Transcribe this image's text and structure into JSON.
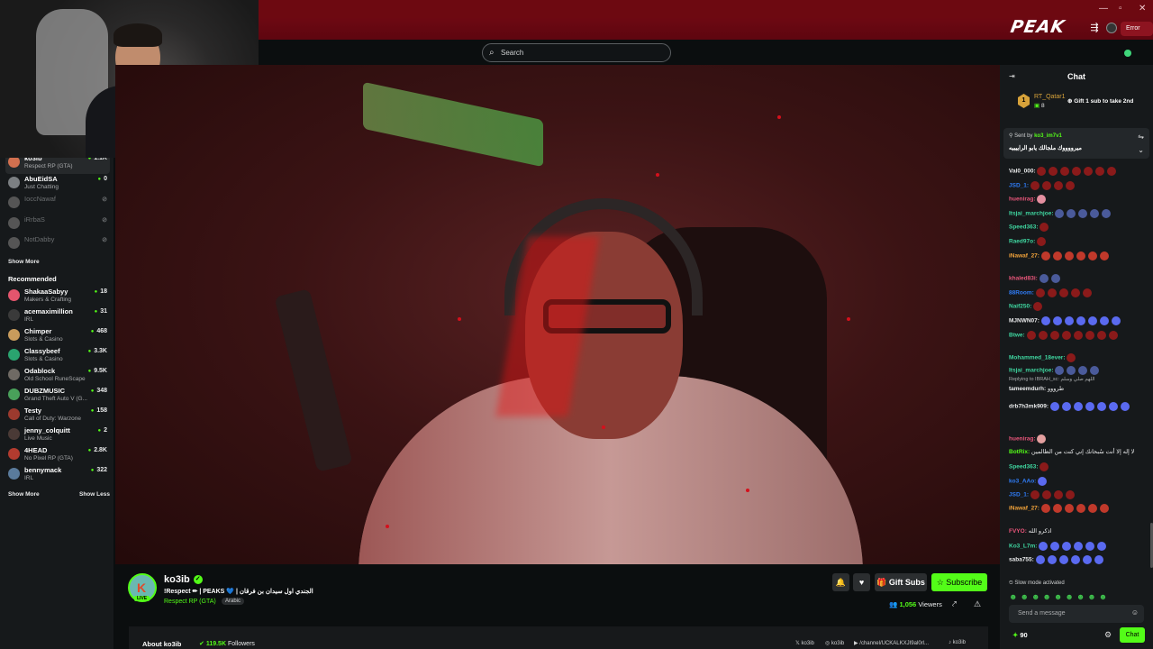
{
  "app": {
    "logo": "PEAK",
    "window_controls": [
      "—",
      "▫",
      "✕"
    ],
    "user_button": "Error",
    "search_placeholder": "Search"
  },
  "sidebar": {
    "following": [
      {
        "name": "ko3ib",
        "sub": "Respect RP (GTA)",
        "count": "1.1K",
        "online": true,
        "color": "#d2704f"
      },
      {
        "name": "AbuEidSA",
        "sub": "Just Chatting",
        "count": "0",
        "online": true,
        "color": "#7b7f82"
      },
      {
        "name": "IoccNawaf",
        "sub": "",
        "count": "",
        "online": false,
        "color": "#555"
      },
      {
        "name": "iRrbaS",
        "sub": "",
        "count": "",
        "online": false,
        "color": "#555"
      },
      {
        "name": "NotDabby",
        "sub": "",
        "count": "",
        "online": false,
        "color": "#555"
      }
    ],
    "show_more": "Show More",
    "recommended_title": "Recommended",
    "recommended": [
      {
        "name": "ShakaaSabyy",
        "sub": "Makers & Crafting",
        "count": "18",
        "color": "#e4556d"
      },
      {
        "name": "acemaximillion",
        "sub": "IRL",
        "count": "31",
        "color": "#3a3a3a"
      },
      {
        "name": "Chimper",
        "sub": "Slots & Casino",
        "count": "468",
        "color": "#c89b5c"
      },
      {
        "name": "Classybeef",
        "sub": "Slots & Casino",
        "count": "3.3K",
        "color": "#2aa46f"
      },
      {
        "name": "Odablock",
        "sub": "Old School RuneScape",
        "count": "9.5K",
        "color": "#6f6a64"
      },
      {
        "name": "DUBZMUSIC",
        "sub": "Grand Theft Auto V (G...",
        "count": "348",
        "color": "#49a05a"
      },
      {
        "name": "Testy",
        "sub": "Call of Duty: Warzone",
        "count": "158",
        "color": "#9c3a2e"
      },
      {
        "name": "jenny_colquitt",
        "sub": "Live Music",
        "count": "2",
        "color": "#4a3a36"
      },
      {
        "name": "4HEAD",
        "sub": "No Pixel RP (GTA)",
        "count": "2.8K",
        "color": "#b23b2f"
      },
      {
        "name": "bennymack",
        "sub": "IRL",
        "count": "322",
        "color": "#5a7b9c"
      }
    ],
    "show_more_2": "Show More",
    "show_less": "Show Less"
  },
  "channel": {
    "name": "ko3ib",
    "title": "!Respect ✏ | PEAKS 💙 | الجندي اول سيدان بن فرقان",
    "category": "Respect RP (GTA)",
    "tag": "Arabic",
    "live": "LIVE",
    "gift_subs": "Gift Subs",
    "subscribe": "Subscribe",
    "viewers_count": "1,056",
    "viewers_label": "Viewers"
  },
  "about": {
    "title": "About ko3ib",
    "followers_count": "119.5K",
    "followers_label": "Followers",
    "socials": [
      "ko3ib",
      "ko3ib",
      "/channel/UCKALKXJI9al0rl...",
      "ko3ib"
    ]
  },
  "chat": {
    "title": "Chat",
    "gift_leader": {
      "rank": "1",
      "name": "RT_Qatar1",
      "count": "8",
      "cta": "Gift 1 sub to take 2nd"
    },
    "pinned": {
      "sent_by_label": "Sent by",
      "sent_by": "ko3_im7v1",
      "message": "ميرووووك ملجالك يابو الراييبيه"
    },
    "messages": [
      {
        "user": "Val0_000:",
        "color": "#e9eaeb",
        "text": "",
        "emotes": 7,
        "emote_color": "#8a1a1a"
      },
      {
        "user": "JSD_1:",
        "color": "#2f7cf6",
        "text": "",
        "emotes": 4,
        "emote_color": "#8a1a1a"
      },
      {
        "user": "huenirag:",
        "color": "#e9557a",
        "text": "",
        "emotes": 1,
        "emote_color": "#e48fa0"
      },
      {
        "user": "Itsjai_marchjoe:",
        "color": "#3fd6a0",
        "text": "",
        "emotes": 5,
        "emote_color": "#4a5a9a"
      },
      {
        "user": "Speed363:",
        "color": "#3fd6a0",
        "text": "",
        "emotes": 1,
        "emote_color": "#8a1a1a"
      },
      {
        "user": "Raed97o:",
        "color": "#3fd6a0",
        "text": "",
        "emotes": 1,
        "emote_color": "#8a1a1a"
      },
      {
        "user": "iNawaf_27:",
        "color": "#f2a33a",
        "text": "",
        "emotes": 6,
        "emote_color": "#c0392b"
      },
      {
        "user": "khaled83i:",
        "color": "#e9557a",
        "text": "",
        "emotes": 2,
        "emote_color": "#4a5a9a"
      },
      {
        "user": "88Room:",
        "color": "#2f7cf6",
        "text": "",
        "emotes": 5,
        "emote_color": "#8a1a1a"
      },
      {
        "user": "Naif250:",
        "color": "#3fd6a0",
        "text": "",
        "emotes": 1,
        "emote_color": "#8a1a1a"
      },
      {
        "user": "MJNWN07:",
        "color": "#e9eaeb",
        "text": "",
        "emotes": 7,
        "emote_color": "#5a6af0"
      },
      {
        "user": "Btwe:",
        "color": "#3fd6a0",
        "text": "",
        "emotes": 8,
        "emote_color": "#8a1a1a"
      },
      {
        "user": "Mohammed_18ever:",
        "color": "#3fd6a0",
        "text": "",
        "emotes": 1,
        "emote_color": "#8a1a1a"
      },
      {
        "user": "Itsjai_marchjoe:",
        "color": "#3fd6a0",
        "text": "",
        "emotes": 4,
        "emote_color": "#4a5a9a"
      },
      {
        "user": "tameemdurh:",
        "color": "#e9eaeb",
        "text": "طرووو",
        "emotes": 0,
        "emote_color": "#8a1a1a"
      },
      {
        "user": "drb7h3mk909:",
        "color": "#e9eaeb",
        "text": "",
        "emotes": 7,
        "emote_color": "#5a6af0"
      },
      {
        "user": "huenirag:",
        "color": "#e9557a",
        "text": "",
        "emotes": 1,
        "emote_color": "#e4a0a0"
      },
      {
        "user": "BotRix:",
        "color": "#53fc18",
        "text": "لا إله إلا أنت سُبحانك إني كنت من الظالمين",
        "emotes": 0,
        "emote_color": "#8a1a1a"
      },
      {
        "user": "Speed363:",
        "color": "#3fd6a0",
        "text": "",
        "emotes": 1,
        "emote_color": "#8a1a1a"
      },
      {
        "user": "ko3_AAo:",
        "color": "#2f7cf6",
        "text": "",
        "emotes": 1,
        "emote_color": "#5a6af0"
      },
      {
        "user": "JSD_1:",
        "color": "#2f7cf6",
        "text": "",
        "emotes": 4,
        "emote_color": "#8a1a1a"
      },
      {
        "user": "iNawaf_27:",
        "color": "#f2a33a",
        "text": "",
        "emotes": 6,
        "emote_color": "#c0392b"
      },
      {
        "user": "FVYO:",
        "color": "#e9557a",
        "text": "اذكرو الله",
        "emotes": 0,
        "emote_color": "#8a1a1a"
      },
      {
        "user": "Ko3_L7m:",
        "color": "#3fd6a0",
        "text": "",
        "emotes": 6,
        "emote_color": "#5a6af0"
      },
      {
        "user": "saba755:",
        "color": "#e9eaeb",
        "text": "",
        "emotes": 6,
        "emote_color": "#5a6af0"
      }
    ],
    "reply_note": "Replying to IBRAH_sc: اللهم صلي وسلم",
    "slow_mode": "Slow mode activated",
    "input_placeholder": "Send a message",
    "points": "90",
    "send": "Chat"
  }
}
